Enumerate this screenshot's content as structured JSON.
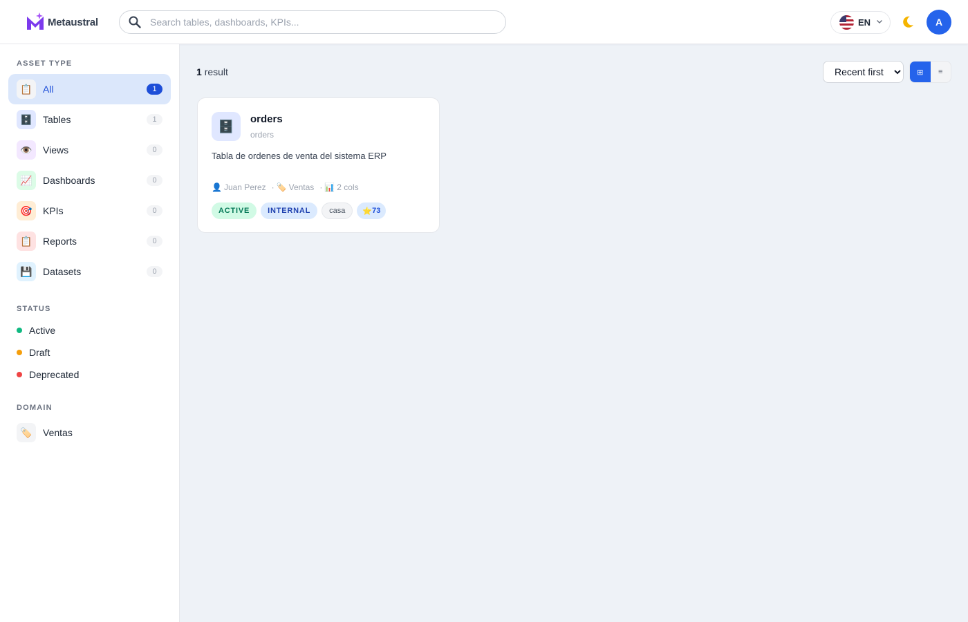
{
  "header": {
    "brand": "Metaustral",
    "search_placeholder": "Search tables, dashboards, KPIs...",
    "language": "EN",
    "avatar_initial": "A"
  },
  "sidebar": {
    "asset_type_title": "ASSET TYPE",
    "asset_types": [
      {
        "label": "All",
        "count": "1",
        "icon": "📋",
        "bg": "#f3f4f6"
      },
      {
        "label": "Tables",
        "count": "1",
        "icon": "🗄️",
        "bg": "#e0e7ff"
      },
      {
        "label": "Views",
        "count": "0",
        "icon": "👁️",
        "bg": "#f3e8ff"
      },
      {
        "label": "Dashboards",
        "count": "0",
        "icon": "📈",
        "bg": "#dcfce7"
      },
      {
        "label": "KPIs",
        "count": "0",
        "icon": "🎯",
        "bg": "#ffedd5"
      },
      {
        "label": "Reports",
        "count": "0",
        "icon": "📋",
        "bg": "#fee2e2"
      },
      {
        "label": "Datasets",
        "count": "0",
        "icon": "💾",
        "bg": "#e0f2fe"
      }
    ],
    "status_title": "STATUS",
    "statuses": [
      {
        "label": "Active",
        "color": "#10b981"
      },
      {
        "label": "Draft",
        "color": "#f59e0b"
      },
      {
        "label": "Deprecated",
        "color": "#ef4444"
      }
    ],
    "domain_title": "DOMAIN",
    "domains": [
      {
        "label": "Ventas",
        "icon": "🏷️"
      }
    ]
  },
  "main": {
    "result_number": "1",
    "result_label": "result",
    "sort_selected": "Recent first",
    "view_grid_icon": "⊞",
    "view_list_icon": "≡"
  },
  "card": {
    "icon": "🗄️",
    "title": "orders",
    "subtitle": "orders",
    "description": "Tabla de ordenes de venta del sistema ERP",
    "owner_icon": "👤",
    "owner": "Juan Perez",
    "domain_icon": "🏷️",
    "domain": "Ventas",
    "cols_icon": "📊",
    "cols": "2 cols",
    "separator": "·",
    "status_tag": "ACTIVE",
    "visibility_tag": "INTERNAL",
    "tag": "casa",
    "star_icon": "⭐",
    "score": "73"
  }
}
